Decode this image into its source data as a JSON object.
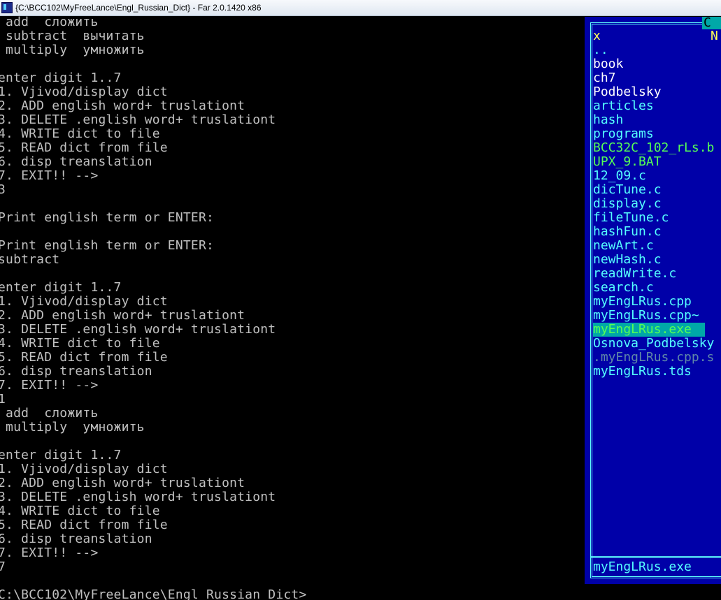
{
  "window": {
    "title": "{C:\\BCC102\\MyFreeLance\\Engl_Russian_Dict} - Far 2.0.1420 x86"
  },
  "console": {
    "lines": [
      " add  сложить",
      " subtract  вычитать",
      " multiply  умножить",
      "",
      "enter digit 1..7",
      "1. Vjivod/display dict",
      "2. ADD english word+ truslationt",
      "3. DELETE .english word+ truslationt",
      "4. WRITE dict to file",
      "5. READ dict from file",
      "6. disp treanslation",
      "7. EXIT!! -->",
      "3",
      "",
      "Print english term or ENTER:",
      "",
      "Print english term or ENTER:",
      "subtract",
      "",
      "enter digit 1..7",
      "1. Vjivod/display dict",
      "2. ADD english word+ truslationt",
      "3. DELETE .english word+ truslationt",
      "4. WRITE dict to file",
      "5. READ dict from file",
      "6. disp treanslation",
      "7. EXIT!! -->",
      "1",
      " add  сложить",
      " multiply  умножить",
      "",
      "enter digit 1..7",
      "1. Vjivod/display dict",
      "2. ADD english word+ truslationt",
      "3. DELETE .english word+ truslationt",
      "4. WRITE dict to file",
      "5. READ dict from file",
      "6. disp treanslation",
      "7. EXIT!! -->",
      "7",
      "",
      "C:\\BCC102\\MyFreeLance\\Engl_Russian_Dict>"
    ]
  },
  "panel": {
    "tab_label": "C",
    "column_x": "x",
    "column_n": "N",
    "files": [
      {
        "name": "..",
        "color": "cyan"
      },
      {
        "name": "book",
        "color": "white"
      },
      {
        "name": "ch7",
        "color": "white"
      },
      {
        "name": "Podbelsky",
        "color": "white"
      },
      {
        "name": "articles",
        "color": "cyan"
      },
      {
        "name": "hash",
        "color": "cyan"
      },
      {
        "name": "programs",
        "color": "cyan"
      },
      {
        "name": "BCC32C_102_rLs.b",
        "color": "green"
      },
      {
        "name": "UPX_9.BAT",
        "color": "green"
      },
      {
        "name": "12_09.c",
        "color": "cyan"
      },
      {
        "name": "dicTune.c",
        "color": "cyan"
      },
      {
        "name": "display.c",
        "color": "cyan"
      },
      {
        "name": "fileTune.c",
        "color": "cyan"
      },
      {
        "name": "hashFun.c",
        "color": "cyan"
      },
      {
        "name": "newArt.c",
        "color": "cyan"
      },
      {
        "name": "newHash.c",
        "color": "cyan"
      },
      {
        "name": "readWrite.c",
        "color": "cyan"
      },
      {
        "name": "search.c",
        "color": "cyan"
      },
      {
        "name": "myEngLRus.cpp",
        "color": "cyan"
      },
      {
        "name": "myEngLRus.cpp~",
        "color": "cyan"
      },
      {
        "name": "myEngLRus.exe",
        "color": "selected"
      },
      {
        "name": "Osnova_Podbelsky",
        "color": "cyan"
      },
      {
        "name": ".myEngLRus.cpp.s",
        "color": "gray"
      },
      {
        "name": "myEngLRus.tds",
        "color": "cyan"
      }
    ],
    "status": "myEngLRus.exe"
  },
  "colors": {
    "panel_bg": "#0000a8",
    "panel_frame": "#5ffcfc",
    "console_text": "#c0c0c0"
  }
}
